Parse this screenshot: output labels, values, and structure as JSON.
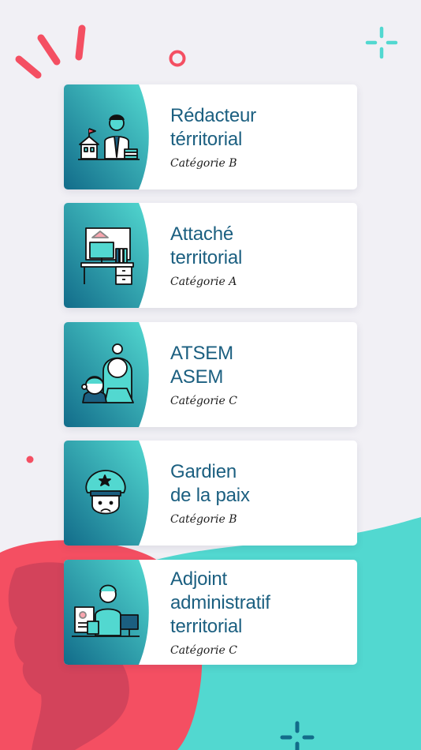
{
  "colors": {
    "teal_light": "#52d8d0",
    "teal_dark": "#126c8a",
    "coral": "#f44f62",
    "title_blue": "#1b5f80",
    "background": "#f1f0f5"
  },
  "cards": [
    {
      "title": "Rédacteur\ntérritorial",
      "category": "Catégorie B",
      "icon": "civil-servant-building-icon"
    },
    {
      "title": "Attaché\nterritorial",
      "category": "Catégorie A",
      "icon": "office-desk-icon"
    },
    {
      "title": "ATSEM\nASEM",
      "category": "Catégorie C",
      "icon": "woman-child-icon"
    },
    {
      "title": "Gardien\nde la paix",
      "category": "Catégorie B",
      "icon": "police-officer-icon"
    },
    {
      "title": "Adjoint\nadministratif\nterritorial",
      "category": "Catégorie C",
      "icon": "administrative-clerk-icon"
    }
  ]
}
